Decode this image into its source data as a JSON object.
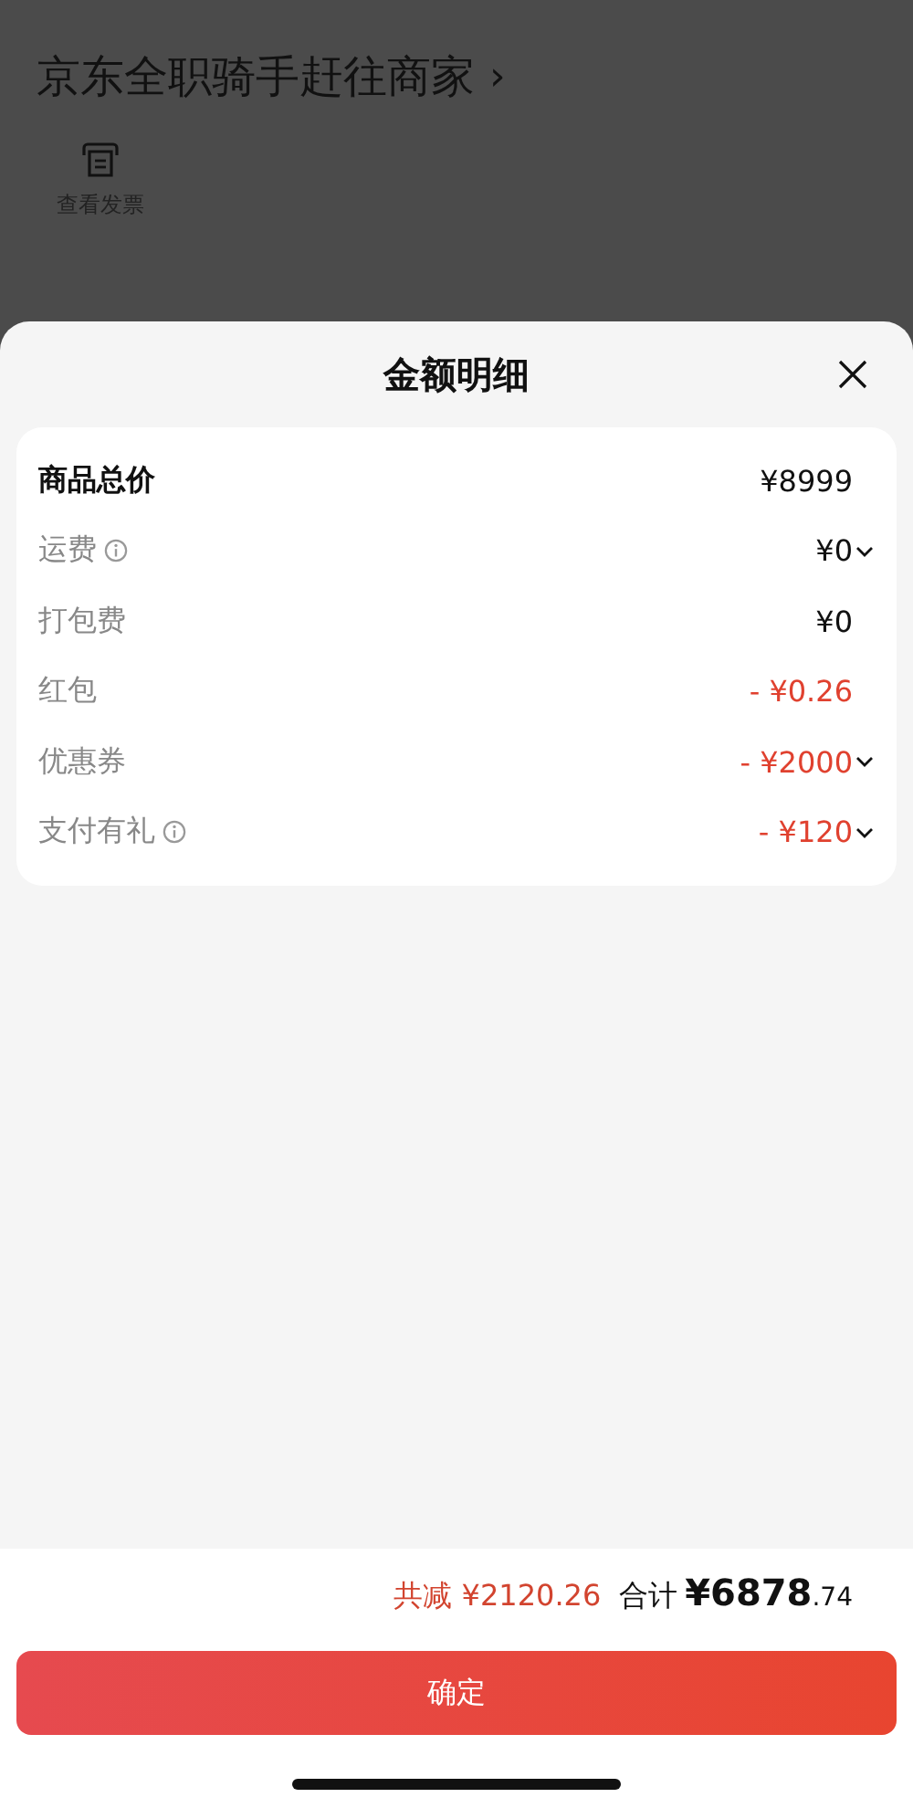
{
  "background": {
    "title": "京东全职骑手赶往商家",
    "title_arrow": "›",
    "action_label": "查看发票"
  },
  "sheet": {
    "title": "金额明细",
    "rows": [
      {
        "kind": "total",
        "label": "商品总价",
        "value": "¥8999",
        "has_info": false,
        "expandable": false
      },
      {
        "kind": "fee",
        "label": "运费",
        "value": "¥0",
        "has_info": true,
        "expandable": true
      },
      {
        "kind": "fee",
        "label": "打包费",
        "value": "¥0",
        "has_info": false,
        "expandable": false
      },
      {
        "kind": "discount",
        "label": "红包",
        "value": "- ¥0.26",
        "has_info": false,
        "expandable": false
      },
      {
        "kind": "discount",
        "label": "优惠券",
        "value": "- ¥2000",
        "has_info": false,
        "expandable": true
      },
      {
        "kind": "discount",
        "label": "支付有礼",
        "value": "- ¥120",
        "has_info": true,
        "expandable": true
      }
    ]
  },
  "footer": {
    "saving": "共减 ¥2120.26",
    "total_label": "合计",
    "total_integer": "¥6878",
    "total_decimal": ".74",
    "confirm": "确定"
  }
}
